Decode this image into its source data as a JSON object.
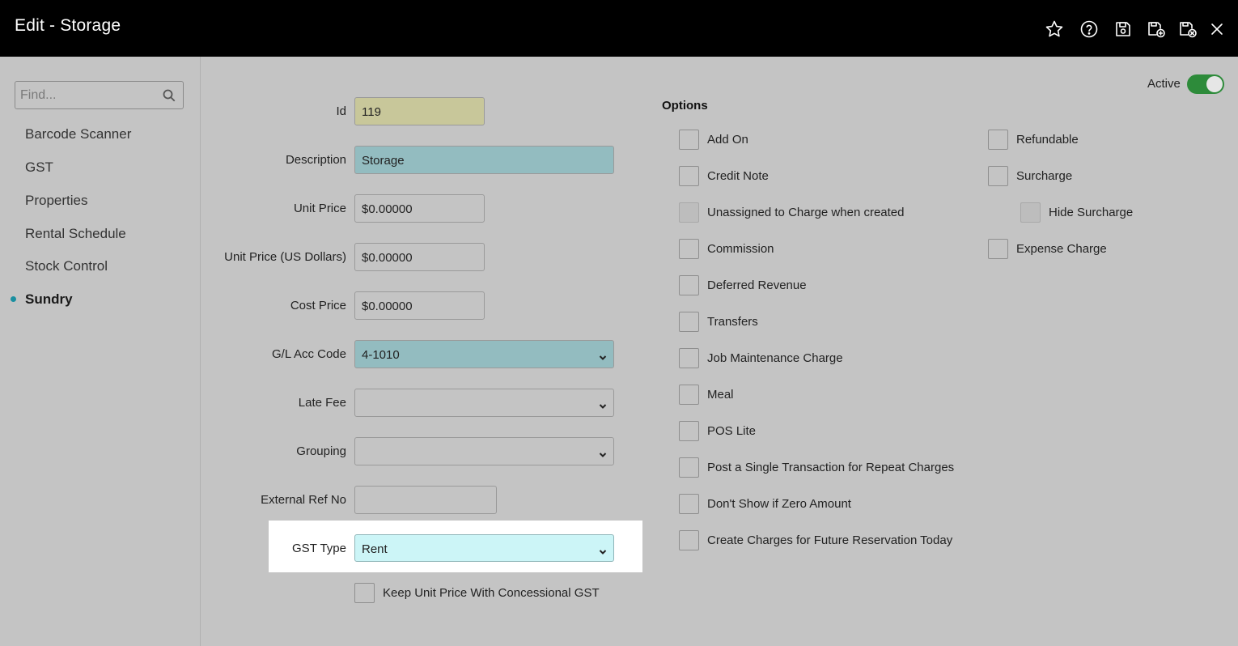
{
  "window": {
    "title": "Edit - Storage"
  },
  "toolbar": {
    "icons": [
      "star-icon",
      "help-icon",
      "save-icon",
      "save-and-new-icon",
      "save-and-close-icon",
      "close-icon"
    ]
  },
  "sidebar": {
    "search_placeholder": "Find...",
    "items": [
      {
        "label": "Barcode Scanner"
      },
      {
        "label": "GST"
      },
      {
        "label": "Properties"
      },
      {
        "label": "Rental Schedule"
      },
      {
        "label": "Stock Control"
      },
      {
        "label": "Sundry",
        "active": true
      }
    ]
  },
  "form": {
    "id": {
      "label": "Id",
      "value": "119"
    },
    "description": {
      "label": "Description",
      "value": "Storage"
    },
    "unit_price": {
      "label": "Unit Price",
      "value": "$0.00000"
    },
    "unit_price_usd": {
      "label": "Unit Price (US Dollars)",
      "value": "$0.00000"
    },
    "cost_price": {
      "label": "Cost Price",
      "value": "$0.00000"
    },
    "gl_acc_code": {
      "label": "G/L Acc Code",
      "value": "4-1010"
    },
    "late_fee": {
      "label": "Late Fee",
      "value": ""
    },
    "grouping": {
      "label": "Grouping",
      "value": ""
    },
    "external_ref": {
      "label": "External Ref No",
      "value": ""
    },
    "gst_type": {
      "label": "GST Type",
      "value": "Rent"
    },
    "keep_unit_price": {
      "label": "Keep Unit Price With Concessional GST",
      "checked": false
    }
  },
  "status": {
    "active_label": "Active",
    "active": true
  },
  "options": {
    "heading": "Options",
    "left": [
      {
        "label": "Add On",
        "checked": false
      },
      {
        "label": "Credit Note",
        "checked": false
      },
      {
        "label": "Unassigned to Charge when created",
        "checked": false,
        "disabled": true
      },
      {
        "label": "Commission",
        "checked": false
      },
      {
        "label": "Deferred Revenue",
        "checked": false
      },
      {
        "label": "Transfers",
        "checked": false
      },
      {
        "label": "Job Maintenance Charge",
        "checked": false
      },
      {
        "label": "Meal",
        "checked": false
      },
      {
        "label": "POS Lite",
        "checked": false
      },
      {
        "label": "Post a Single Transaction for Repeat Charges",
        "checked": false
      },
      {
        "label": "Don't Show if Zero Amount",
        "checked": false
      },
      {
        "label": "Create Charges for Future Reservation Today",
        "checked": false
      }
    ],
    "right": [
      {
        "label": "Refundable",
        "checked": false
      },
      {
        "label": "Surcharge",
        "checked": false
      },
      {
        "label": "Hide Surcharge",
        "checked": false,
        "disabled": true
      },
      {
        "label": "Expense Charge",
        "checked": false
      }
    ]
  },
  "colors": {
    "titlebar": "#000000",
    "background": "#c4c4c4",
    "id_field": "#c8c79a",
    "teal_field": "#93bcc0",
    "gst_field": "#ccf5f7",
    "toggle_on": "#2d8b3a",
    "nav_dot": "#1a8fa0"
  }
}
